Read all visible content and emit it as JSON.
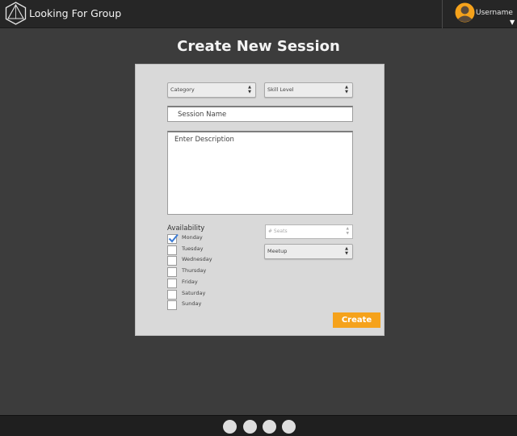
{
  "header": {
    "app_title": "Looking For Group",
    "username": "Username",
    "logo_icon": "hexagon-triangle-logo",
    "avatar_icon": "user-avatar-icon",
    "caret": "▼"
  },
  "page": {
    "title": "Create New Session"
  },
  "form": {
    "category": {
      "selected": "Category"
    },
    "skill_level": {
      "selected": "Skill Level"
    },
    "session_name": {
      "placeholder": "Session Name"
    },
    "description": {
      "placeholder": "Enter Description"
    },
    "availability": {
      "label": "Availability",
      "days": [
        {
          "label": "Monday",
          "checked": true
        },
        {
          "label": "Tuesday",
          "checked": false
        },
        {
          "label": "Wednesday",
          "checked": false
        },
        {
          "label": "Thursday",
          "checked": false
        },
        {
          "label": "Friday",
          "checked": false
        },
        {
          "label": "Saturday",
          "checked": false
        },
        {
          "label": "Sunday",
          "checked": false
        }
      ]
    },
    "seats": {
      "placeholder": "# Seats"
    },
    "meeting_type": {
      "selected": "Meetup"
    },
    "create_label": "Create"
  },
  "footer": {
    "page_dots": 4
  },
  "colors": {
    "background": "#3c3c3c",
    "topbar": "#262626",
    "card": "#d9d9d9",
    "accent": "#f5a21b",
    "avatar": "#f5a21b",
    "check": "#3a7bd5"
  }
}
